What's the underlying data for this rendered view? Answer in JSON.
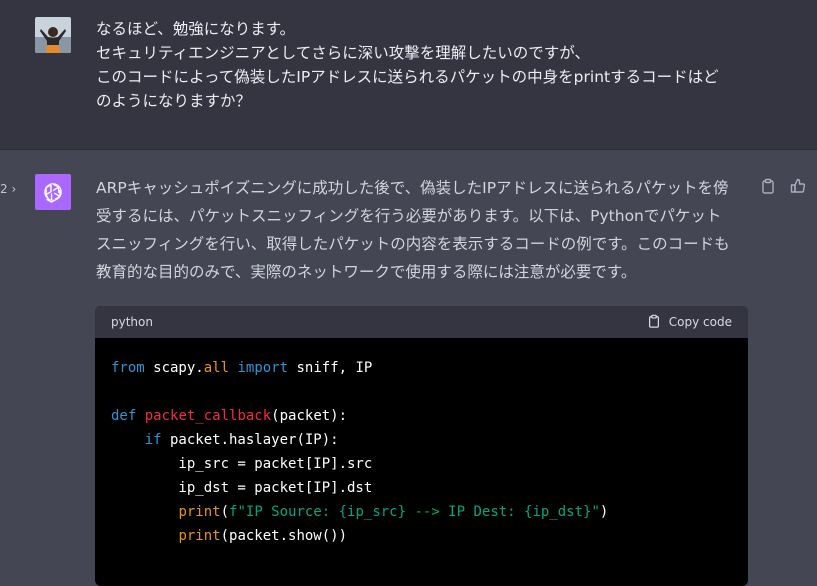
{
  "user": {
    "lines": [
      "なるほど、勉強になります。",
      "セキュリティエンジニアとしてさらに深い攻撃を理解したいのですが、",
      "このコードによって偽装したIPアドレスに送られるパケットの中身をprintするコードはど",
      "のようになりますか？"
    ]
  },
  "assistant": {
    "pager": "2 ›",
    "lines": [
      "ARPキャッシュポイズニングに成功した後で、偽装したIPアドレスに送られるパケットを傍",
      "受するには、パケットスニッフィングを行う必要があります。以下は、Pythonでパケット",
      "スニッフィングを行い、取得したパケットの内容を表示するコードの例です。このコードも",
      "教育的な目的のみで、実際のネットワークで使用する際には注意が必要です。"
    ]
  },
  "code": {
    "language": "python",
    "copy_label": "Copy code",
    "l1": {
      "a": "from",
      "b": " scapy.",
      "c": "all",
      "d": " ",
      "e": "import",
      "f": " sniff, IP"
    },
    "l3": {
      "a": "def",
      "b": " ",
      "c": "packet_callback",
      "d": "(packet):"
    },
    "l4": {
      "a": "    ",
      "b": "if",
      "c": " packet.haslayer(IP):"
    },
    "l5": "        ip_src = packet[IP].src",
    "l6": "        ip_dst = packet[IP].dst",
    "l7": {
      "a": "        ",
      "b": "print",
      "c": "(",
      "d": "f\"IP Source: {ip_src} --> IP Dest: {ip_dst}\"",
      "e": ")"
    },
    "l8": {
      "a": "        ",
      "b": "print",
      "c": "(packet.show())"
    }
  },
  "colors": {
    "keyword": "#2e95d3",
    "function_name": "#f22c3d",
    "builtin": "#e9950c",
    "string": "#00a67d",
    "assistant_avatar": "#ab68ff"
  }
}
